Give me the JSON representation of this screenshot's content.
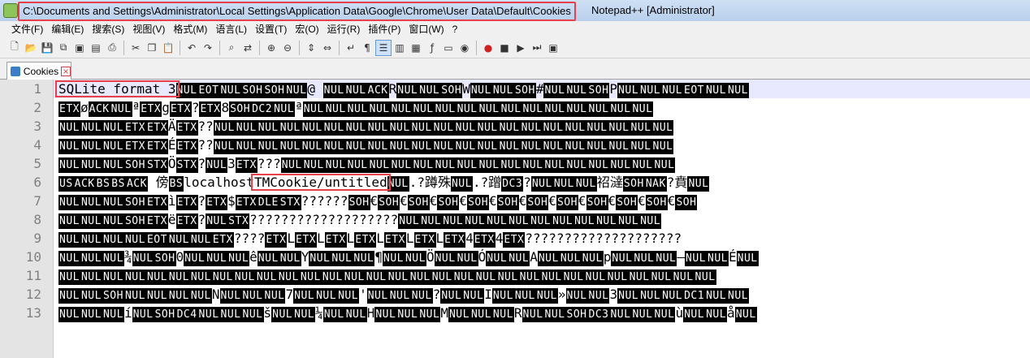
{
  "window": {
    "title_path": "C:\\Documents and Settings\\Administrator\\Local Settings\\Application Data\\Google\\Chrome\\User Data\\Default\\Cookies",
    "title_rest": "Notepad++ [Administrator]"
  },
  "menu": [
    "文件(F)",
    "编辑(E)",
    "搜索(S)",
    "视图(V)",
    "格式(M)",
    "语言(L)",
    "设置(T)",
    "宏(O)",
    "运行(R)",
    "插件(P)",
    "窗口(W)",
    "?"
  ],
  "tab": {
    "label": "Cookies"
  },
  "line_numbers": [
    "1",
    "2",
    "3",
    "4",
    "5",
    "6",
    "7",
    "8",
    "9",
    "10",
    "11",
    "12",
    "13"
  ],
  "lines": [
    [
      "SQLite format 3",
      {
        "c": "NUL"
      },
      {
        "c": "EOT"
      },
      {
        "c": "NUL"
      },
      {
        "c": "SOH"
      },
      {
        "c": "SOH"
      },
      {
        "c": "NUL"
      },
      "@  ",
      {
        "c": "NUL"
      },
      {
        "c": "NUL"
      },
      {
        "c": "ACK"
      },
      "R",
      {
        "c": "NUL"
      },
      {
        "c": "NUL"
      },
      {
        "c": "SOH"
      },
      "W",
      {
        "c": "NUL"
      },
      {
        "c": "NUL"
      },
      {
        "c": "SOH"
      },
      "#",
      {
        "c": "NUL"
      },
      {
        "c": "NUL"
      },
      {
        "c": "SOH"
      },
      "P",
      {
        "c": "NUL"
      },
      {
        "c": "NUL"
      },
      {
        "c": "NUL"
      },
      {
        "c": "EOT"
      },
      {
        "c": "NUL"
      },
      {
        "c": "NUL"
      }
    ],
    [
      {
        "c": "ETX"
      },
      "ø",
      {
        "c": "ACK"
      },
      {
        "c": "NUL"
      },
      "ª",
      {
        "c": "ETX"
      },
      "g",
      {
        "c": "ETX"
      },
      "?",
      {
        "c": "ETX"
      },
      "8",
      {
        "c": "SOH"
      },
      {
        "c": "DC2"
      },
      {
        "c": "NUL"
      },
      "ª",
      {
        "c": "NUL"
      },
      {
        "c": "NUL"
      },
      {
        "c": "NUL"
      },
      {
        "c": "NUL"
      },
      {
        "c": "NUL"
      },
      {
        "c": "NUL"
      },
      {
        "c": "NUL"
      },
      {
        "c": "NUL"
      },
      {
        "c": "NUL"
      },
      {
        "c": "NUL"
      },
      {
        "c": "NUL"
      },
      {
        "c": "NUL"
      },
      {
        "c": "NUL"
      },
      {
        "c": "NUL"
      },
      {
        "c": "NUL"
      },
      {
        "c": "NUL"
      }
    ],
    [
      {
        "c": "NUL"
      },
      {
        "c": "NUL"
      },
      {
        "c": "NUL"
      },
      {
        "c": "ETX"
      },
      {
        "c": "ETX"
      },
      "Ä",
      {
        "c": "ETX"
      },
      "??",
      {
        "c": "NUL"
      },
      {
        "c": "NUL"
      },
      {
        "c": "NUL"
      },
      {
        "c": "NUL"
      },
      {
        "c": "NUL"
      },
      {
        "c": "NUL"
      },
      {
        "c": "NUL"
      },
      {
        "c": "NUL"
      },
      {
        "c": "NUL"
      },
      {
        "c": "NUL"
      },
      {
        "c": "NUL"
      },
      {
        "c": "NUL"
      },
      {
        "c": "NUL"
      },
      {
        "c": "NUL"
      },
      {
        "c": "NUL"
      },
      {
        "c": "NUL"
      },
      {
        "c": "NUL"
      },
      {
        "c": "NUL"
      },
      {
        "c": "NUL"
      },
      {
        "c": "NUL"
      },
      {
        "c": "NUL"
      }
    ],
    [
      {
        "c": "NUL"
      },
      {
        "c": "NUL"
      },
      {
        "c": "NUL"
      },
      {
        "c": "ETX"
      },
      {
        "c": "ETX"
      },
      "É",
      {
        "c": "ETX"
      },
      "??",
      {
        "c": "NUL"
      },
      {
        "c": "NUL"
      },
      {
        "c": "NUL"
      },
      {
        "c": "NUL"
      },
      {
        "c": "NUL"
      },
      {
        "c": "NUL"
      },
      {
        "c": "NUL"
      },
      {
        "c": "NUL"
      },
      {
        "c": "NUL"
      },
      {
        "c": "NUL"
      },
      {
        "c": "NUL"
      },
      {
        "c": "NUL"
      },
      {
        "c": "NUL"
      },
      {
        "c": "NUL"
      },
      {
        "c": "NUL"
      },
      {
        "c": "NUL"
      },
      {
        "c": "NUL"
      },
      {
        "c": "NUL"
      },
      {
        "c": "NUL"
      },
      {
        "c": "NUL"
      },
      {
        "c": "NUL"
      }
    ],
    [
      {
        "c": "NUL"
      },
      {
        "c": "NUL"
      },
      {
        "c": "NUL"
      },
      {
        "c": "SOH"
      },
      {
        "c": "STX"
      },
      "Ö",
      {
        "c": "STX"
      },
      "?",
      {
        "c": "NUL"
      },
      "3",
      {
        "c": "ETX"
      },
      "???",
      {
        "c": "NUL"
      },
      {
        "c": "NUL"
      },
      {
        "c": "NUL"
      },
      {
        "c": "NUL"
      },
      {
        "c": "NUL"
      },
      {
        "c": "NUL"
      },
      {
        "c": "NUL"
      },
      {
        "c": "NUL"
      },
      {
        "c": "NUL"
      },
      {
        "c": "NUL"
      },
      {
        "c": "NUL"
      },
      {
        "c": "NUL"
      },
      {
        "c": "NUL"
      },
      {
        "c": "NUL"
      },
      {
        "c": "NUL"
      },
      {
        "c": "NUL"
      },
      {
        "c": "NUL"
      },
      {
        "c": "NUL"
      }
    ],
    [
      {
        "c": "US"
      },
      {
        "c": "ACK"
      },
      {
        "c": "BS"
      },
      {
        "c": "BS"
      },
      {
        "c": "ACK"
      },
      "             傍",
      {
        "c": "BS"
      },
      "localhost",
      "TMCookie/untitled",
      {
        "c": "NUL"
      },
      ".?蹲殊",
      {
        "c": "NUL"
      },
      ".?蹭",
      {
        "c": "DC3"
      },
      "?",
      {
        "c": "NUL"
      },
      {
        "c": "NUL"
      },
      {
        "c": "NUL"
      },
      "祒澾",
      {
        "c": "SOH"
      },
      {
        "c": "NAK"
      },
      "?賁",
      {
        "c": "NUL"
      }
    ],
    [
      {
        "c": "NUL"
      },
      {
        "c": "NUL"
      },
      {
        "c": "NUL"
      },
      {
        "c": "SOH"
      },
      {
        "c": "ETX"
      },
      "ì",
      {
        "c": "ETX"
      },
      "?",
      {
        "c": "ETX"
      },
      "$",
      {
        "c": "ETX"
      },
      {
        "c": "DLE"
      },
      {
        "c": "STX"
      },
      "??????",
      {
        "c": "SOH"
      },
      "€",
      {
        "c": "SOH"
      },
      "€",
      {
        "c": "SOH"
      },
      "€",
      {
        "c": "SOH"
      },
      "€",
      {
        "c": "SOH"
      },
      "€",
      {
        "c": "SOH"
      },
      "€",
      {
        "c": "SOH"
      },
      "€",
      {
        "c": "SOH"
      },
      "€",
      {
        "c": "SOH"
      },
      "€",
      {
        "c": "SOH"
      },
      "€",
      {
        "c": "SOH"
      },
      "€",
      {
        "c": "SOH"
      }
    ],
    [
      {
        "c": "NUL"
      },
      {
        "c": "NUL"
      },
      {
        "c": "NUL"
      },
      {
        "c": "SOH"
      },
      {
        "c": "ETX"
      },
      "ë",
      {
        "c": "ETX"
      },
      "?",
      {
        "c": "NUL"
      },
      {
        "c": "STX"
      },
      "????????????",
      "?",
      "?",
      "?",
      "?",
      "?",
      "?",
      "?",
      {
        "c": "NUL"
      },
      {
        "c": "NUL"
      },
      {
        "c": "NUL"
      },
      {
        "c": "NUL"
      },
      {
        "c": "NUL"
      },
      {
        "c": "NUL"
      },
      {
        "c": "NUL"
      },
      {
        "c": "NUL"
      },
      {
        "c": "NUL"
      },
      {
        "c": "NUL"
      },
      {
        "c": "NUL"
      },
      {
        "c": "NUL"
      }
    ],
    [
      {
        "c": "NUL"
      },
      {
        "c": "NUL"
      },
      {
        "c": "NUL"
      },
      {
        "c": "NUL"
      },
      {
        "c": "EOT"
      },
      {
        "c": "NUL"
      },
      {
        "c": "NUL"
      },
      {
        "c": "ETX"
      },
      "????",
      {
        "c": "ETX"
      },
      "L",
      {
        "c": "ETX"
      },
      "L",
      {
        "c": "ETX"
      },
      "L",
      {
        "c": "ETX"
      },
      "L",
      {
        "c": "ETX"
      },
      "L",
      {
        "c": "ETX"
      },
      "L",
      {
        "c": "ETX"
      },
      "4",
      {
        "c": "ETX"
      },
      "4",
      {
        "c": "ETX"
      },
      "????????????",
      "?",
      "?",
      "?",
      "?",
      "?",
      "?",
      "?",
      "?"
    ],
    [
      {
        "c": "NUL"
      },
      {
        "c": "NUL"
      },
      {
        "c": "NUL"
      },
      "¾",
      {
        "c": "NUL"
      },
      {
        "c": "SOH"
      },
      "0",
      {
        "c": "NUL"
      },
      {
        "c": "NUL"
      },
      {
        "c": "NUL"
      },
      "ê",
      {
        "c": "NUL"
      },
      {
        "c": "NUL"
      },
      "Y",
      {
        "c": "NUL"
      },
      {
        "c": "NUL"
      },
      {
        "c": "NUL"
      },
      "¶",
      {
        "c": "NUL"
      },
      {
        "c": "NUL"
      },
      "Ö",
      {
        "c": "NUL"
      },
      {
        "c": "NUL"
      },
      "Ó",
      {
        "c": "NUL"
      },
      {
        "c": "NUL"
      },
      "A",
      {
        "c": "NUL"
      },
      {
        "c": "NUL"
      },
      {
        "c": "NUL"
      },
      "p",
      {
        "c": "NUL"
      },
      {
        "c": "NUL"
      },
      {
        "c": "NUL"
      },
      "—",
      {
        "c": "NUL"
      },
      {
        "c": "NUL"
      },
      "É",
      {
        "c": "NUL"
      }
    ],
    [
      {
        "c": "NUL"
      },
      {
        "c": "NUL"
      },
      {
        "c": "NUL"
      },
      {
        "c": "NUL"
      },
      {
        "c": "NUL"
      },
      {
        "c": "NUL"
      },
      {
        "c": "NUL"
      },
      {
        "c": "NUL"
      },
      {
        "c": "NUL"
      },
      {
        "c": "NUL"
      },
      {
        "c": "NUL"
      },
      {
        "c": "NUL"
      },
      {
        "c": "NUL"
      },
      {
        "c": "NUL"
      },
      {
        "c": "NUL"
      },
      {
        "c": "NUL"
      },
      {
        "c": "NUL"
      },
      {
        "c": "NUL"
      },
      {
        "c": "NUL"
      },
      {
        "c": "NUL"
      },
      {
        "c": "NUL"
      },
      {
        "c": "NUL"
      },
      {
        "c": "NUL"
      },
      {
        "c": "NUL"
      },
      {
        "c": "NUL"
      },
      {
        "c": "NUL"
      },
      {
        "c": "NUL"
      },
      {
        "c": "NUL"
      },
      {
        "c": "NUL"
      },
      {
        "c": "NUL"
      }
    ],
    [
      {
        "c": "NUL"
      },
      {
        "c": "NUL"
      },
      {
        "c": "SOH"
      },
      {
        "c": "NUL"
      },
      {
        "c": "NUL"
      },
      {
        "c": "NUL"
      },
      {
        "c": "NUL"
      },
      "N",
      {
        "c": "NUL"
      },
      {
        "c": "NUL"
      },
      {
        "c": "NUL"
      },
      "7",
      {
        "c": "NUL"
      },
      {
        "c": "NUL"
      },
      {
        "c": "NUL"
      },
      "'",
      {
        "c": "NUL"
      },
      {
        "c": "NUL"
      },
      {
        "c": "NUL"
      },
      "?",
      {
        "c": "NUL"
      },
      {
        "c": "NUL"
      },
      "I",
      {
        "c": "NUL"
      },
      {
        "c": "NUL"
      },
      {
        "c": "NUL"
      },
      "»",
      {
        "c": "NUL"
      },
      {
        "c": "NUL"
      },
      "3",
      {
        "c": "NUL"
      },
      {
        "c": "NUL"
      },
      {
        "c": "NUL"
      },
      {
        "c": "DC1"
      },
      {
        "c": "NUL"
      },
      {
        "c": "NUL"
      }
    ],
    [
      {
        "c": "NUL"
      },
      {
        "c": "NUL"
      },
      {
        "c": "NUL"
      },
      "í",
      {
        "c": "NUL"
      },
      {
        "c": "SOH"
      },
      {
        "c": "DC4"
      },
      {
        "c": "NUL"
      },
      {
        "c": "NUL"
      },
      {
        "c": "NUL"
      },
      "š",
      {
        "c": "NUL"
      },
      {
        "c": "NUL"
      },
      "¼",
      {
        "c": "NUL"
      },
      {
        "c": "NUL"
      },
      "H",
      {
        "c": "NUL"
      },
      {
        "c": "NUL"
      },
      {
        "c": "NUL"
      },
      "M",
      {
        "c": "NUL"
      },
      {
        "c": "NUL"
      },
      {
        "c": "NUL"
      },
      "R",
      {
        "c": "NUL"
      },
      {
        "c": "NUL"
      },
      {
        "c": "SOH"
      },
      {
        "c": "DC3"
      },
      {
        "c": "NUL"
      },
      {
        "c": "NUL"
      },
      {
        "c": "NUL"
      },
      "ù",
      {
        "c": "NUL"
      },
      {
        "c": "NUL"
      },
      "å",
      {
        "c": "NUL"
      }
    ]
  ]
}
